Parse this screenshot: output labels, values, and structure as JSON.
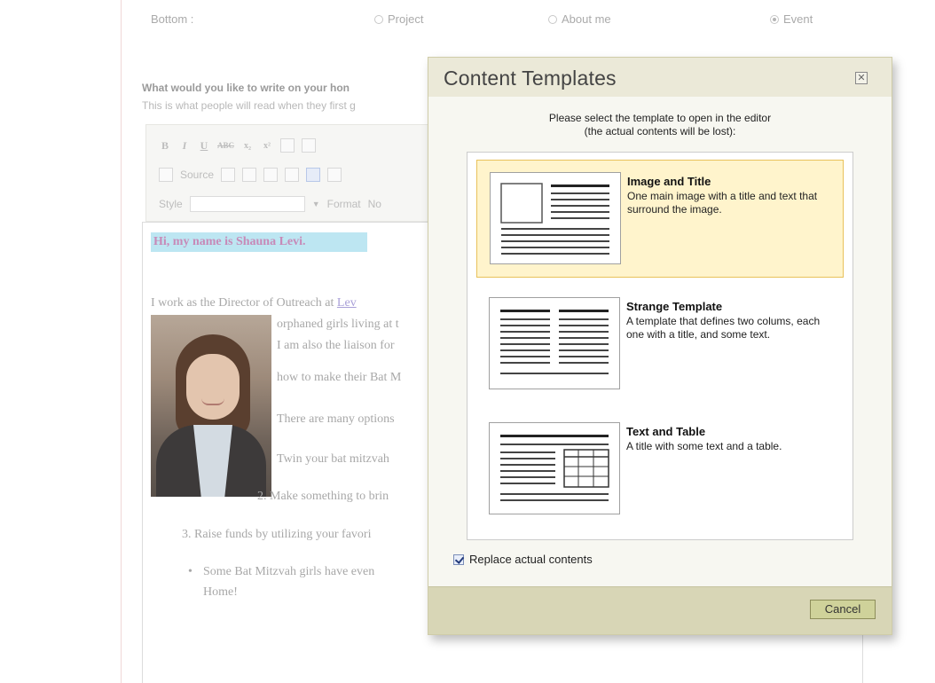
{
  "background": {
    "bottom_label": "Bottom :",
    "radio_options": [
      {
        "label": "Project",
        "checked": false
      },
      {
        "label": "About me",
        "checked": false
      },
      {
        "label": "Event",
        "checked": true
      }
    ],
    "question": "What would you like to write on your hon",
    "question_sub": "This is what people will read when they first g",
    "toolbar": {
      "source_label": "Source",
      "style_label": "Style",
      "format_label": "Format",
      "format_value": "No"
    },
    "editor": {
      "heading": "Hi, my name is Shauna Levi.",
      "line1_prefix": "I work as the Director of Outreach at ",
      "line1_link": "Lev",
      "line2": "orphaned girls living at t",
      "line3": "I am also the liaison for",
      "line4": "how to make their Bat M",
      "line5": "There are many options",
      "line6": "Twin your bat mitzvah",
      "line7": "2. Make something to brin",
      "line8": "3. Raise funds by utilizing your favori",
      "line9": "Some Bat Mitzvah girls have even",
      "line10": "Home!"
    }
  },
  "dialog": {
    "title": "Content Templates",
    "close_symbol": "✕",
    "instruction_line1": "Please select the template to open in the editor",
    "instruction_line2": "(the actual contents will be lost):",
    "templates": [
      {
        "title": "Image and Title",
        "description": "One main image with a title and text that surround the image.",
        "selected": true
      },
      {
        "title": "Strange Template",
        "description": "A template that defines two colums, each one with a title, and some text.",
        "selected": false
      },
      {
        "title": "Text and Table",
        "description": "A title with some text and a table.",
        "selected": false
      }
    ],
    "replace_label": "Replace actual contents",
    "replace_checked": true,
    "cancel_label": "Cancel"
  }
}
